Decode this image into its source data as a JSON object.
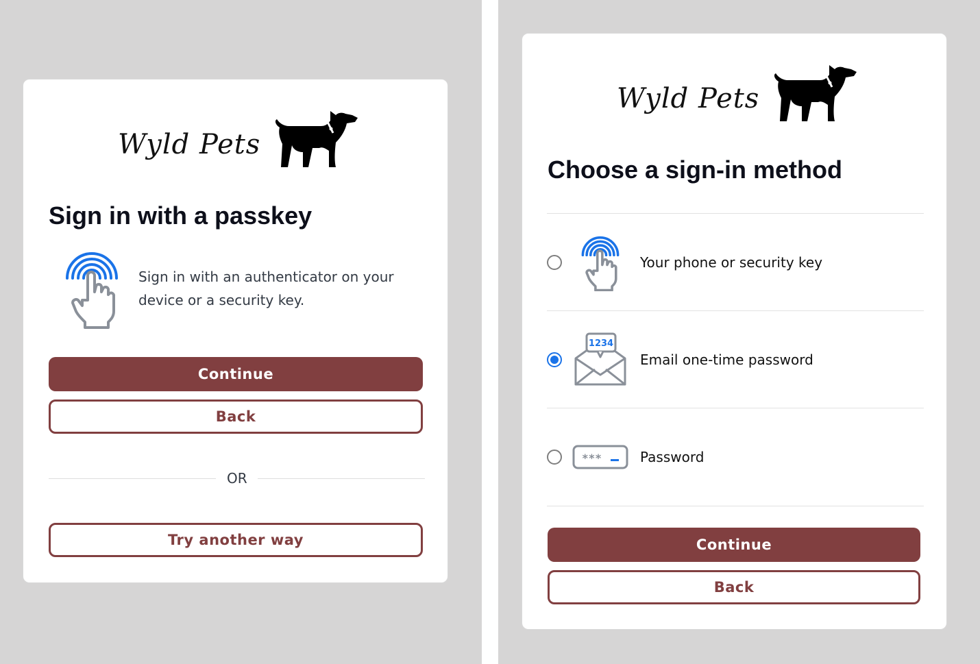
{
  "left_screen": {
    "brand": "Wyld Pets",
    "heading": "Sign in with a passkey",
    "description_line1": "Sign in with an authenticator on your",
    "description_line2": "device or a security key.",
    "continue_label": "Continue",
    "back_label": "Back",
    "or_label": "OR",
    "try_another_label": "Try another way",
    "icons": {
      "passkey": "fingerprint-touch-icon",
      "logo": "dog-icon"
    }
  },
  "right_screen": {
    "brand": "Wyld Pets",
    "heading": "Choose a sign-in method",
    "options": [
      {
        "label": "Your phone or security key",
        "icon": "fingerprint-touch-icon",
        "selected": false
      },
      {
        "label": "Email one-time password",
        "icon": "email-otp-icon",
        "icon_text": "1234",
        "selected": true
      },
      {
        "label": "Password",
        "icon": "password-field-icon",
        "icon_text": "***",
        "selected": false
      }
    ],
    "continue_label": "Continue",
    "back_label": "Back"
  },
  "colors": {
    "accent": "#813f40",
    "radio_selected": "#1a73e8",
    "icon_blue": "#1a73e8",
    "icon_gray": "#8a9099",
    "background": "#d6d5d5"
  }
}
